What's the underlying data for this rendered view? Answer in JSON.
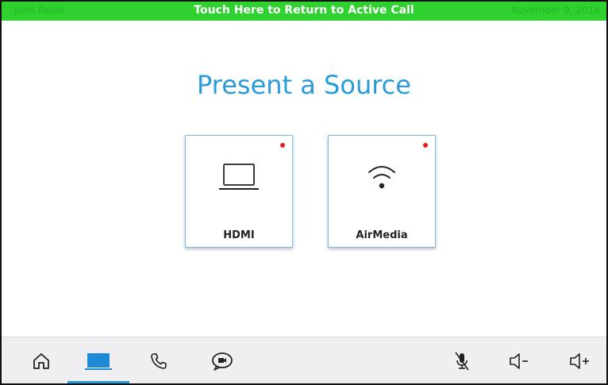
{
  "status_bar": {
    "left_text": "John Pavlik",
    "center_text": "Touch Here to Return to Active Call",
    "right_text": "November 9, 2016",
    "color": "#2fd12f"
  },
  "main": {
    "title": "Present a Source",
    "sources": [
      {
        "label": "HDMI",
        "icon": "laptop-icon",
        "status": "red"
      },
      {
        "label": "AirMedia",
        "icon": "wifi-icon",
        "status": "red"
      }
    ]
  },
  "nav": {
    "items": [
      {
        "icon": "home-icon"
      },
      {
        "icon": "present-icon",
        "active": true
      },
      {
        "icon": "phone-icon"
      },
      {
        "icon": "video-chat-icon"
      },
      {
        "icon": "mic-muted-icon"
      },
      {
        "icon": "volume-down-icon"
      },
      {
        "icon": "volume-up-icon"
      }
    ],
    "accent": "#2a9bd8"
  }
}
